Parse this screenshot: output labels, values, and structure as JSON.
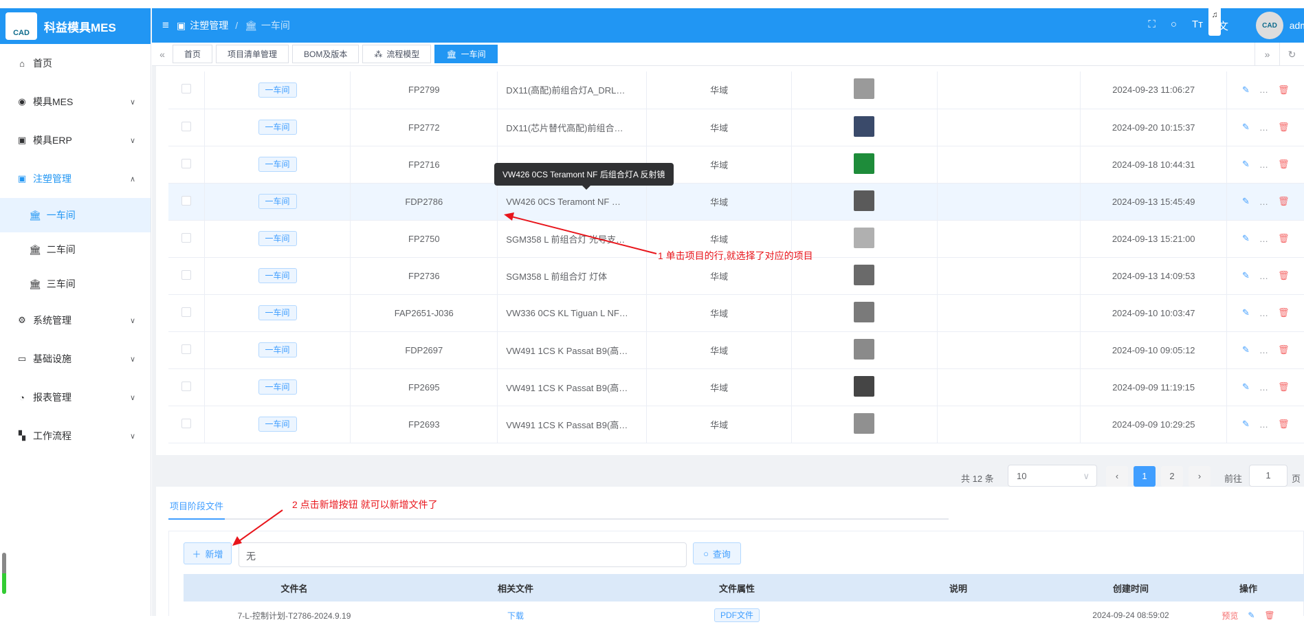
{
  "app": {
    "logo_text": "CAD",
    "title": "科益模具MES"
  },
  "sidebar": {
    "items": [
      {
        "label": "首页",
        "icon": "home-icon"
      },
      {
        "label": "模具MES",
        "icon": "camera-icon"
      },
      {
        "label": "模具ERP",
        "icon": "box-icon"
      },
      {
        "label": "注塑管理",
        "icon": "box-icon"
      },
      {
        "label": "系统管理",
        "icon": "gear-icon"
      },
      {
        "label": "基础设施",
        "icon": "monitor-icon"
      },
      {
        "label": "报表管理",
        "icon": "pie-icon"
      },
      {
        "label": "工作流程",
        "icon": "workflow-icon"
      }
    ],
    "sub_items": [
      {
        "label": "一车间"
      },
      {
        "label": "二车间"
      },
      {
        "label": "三车间"
      }
    ]
  },
  "header": {
    "breadcrumb_parent": "注塑管理",
    "breadcrumb_current": "一车间",
    "user": "adm"
  },
  "tags": [
    {
      "label": "首页"
    },
    {
      "label": "项目清单管理"
    },
    {
      "label": "BOM及版本"
    },
    {
      "label": "流程模型"
    },
    {
      "label": "一车间"
    }
  ],
  "table": {
    "rows": [
      {
        "workshop": "一车间",
        "code": "FP2799",
        "name": "DX11(高配)前组合灯A_DRL…",
        "customer": "华域",
        "thumb_color": "#9a9a9a",
        "created": "2024-09-23 11:06:27"
      },
      {
        "workshop": "一车间",
        "code": "FP2772",
        "name": "DX11(芯片替代高配)前组合…",
        "customer": "华域",
        "thumb_color": "#3a4a6a",
        "created": "2024-09-20 10:15:37"
      },
      {
        "workshop": "一车间",
        "code": "FP2716",
        "name": "",
        "customer": "华域",
        "thumb_color": "#1e8c3a",
        "created": "2024-09-18 10:44:31"
      },
      {
        "workshop": "一车间",
        "code": "FDP2786",
        "name": "VW426 0CS Teramont NF …",
        "customer": "华域",
        "thumb_color": "#5a5a5a",
        "created": "2024-09-13 15:45:49"
      },
      {
        "workshop": "一车间",
        "code": "FP2750",
        "name": "SGM358 L 前组合灯 光导支…",
        "customer": "华域",
        "thumb_color": "#b0b0b0",
        "created": "2024-09-13 15:21:00"
      },
      {
        "workshop": "一车间",
        "code": "FP2736",
        "name": "SGM358 L 前组合灯 灯体",
        "customer": "华域",
        "thumb_color": "#6a6a6a",
        "created": "2024-09-13 14:09:53"
      },
      {
        "workshop": "一车间",
        "code": "FAP2651-J036",
        "name": "VW336 0CS KL Tiguan L NF…",
        "customer": "华域",
        "thumb_color": "#7a7a7a",
        "created": "2024-09-10 10:03:47"
      },
      {
        "workshop": "一车间",
        "code": "FDP2697",
        "name": "VW491 1CS K Passat B9(高…",
        "customer": "华域",
        "thumb_color": "#8a8a8a",
        "created": "2024-09-10 09:05:12"
      },
      {
        "workshop": "一车间",
        "code": "FP2695",
        "name": "VW491 1CS K Passat B9(高…",
        "customer": "华域",
        "thumb_color": "#454545",
        "created": "2024-09-09 11:19:15"
      },
      {
        "workshop": "一车间",
        "code": "FP2693",
        "name": "VW491 1CS K Passat B9(高…",
        "customer": "华域",
        "thumb_color": "#909090",
        "created": "2024-09-09 10:29:25"
      }
    ],
    "tooltip": "VW426 0CS Teramont NF 后组合灯A 反射镜"
  },
  "pager": {
    "total": "共 12 条",
    "page_size": "10",
    "pages": [
      "1",
      "2"
    ],
    "goto_label": "前往",
    "goto_value": "1",
    "page_unit": "页"
  },
  "files": {
    "tab": "项目阶段文件",
    "add_label": "新增",
    "search_value": "无",
    "query_label": "查询",
    "columns": [
      "文件名",
      "相关文件",
      "文件属性",
      "说明",
      "创建时间",
      "操作"
    ],
    "row": {
      "name": "7-L-控制计划-T2786-2024.9.19",
      "download": "下载",
      "type": "PDF文件",
      "desc": "",
      "created": "2024-09-24 08:59:02",
      "preview": "预览"
    }
  },
  "annotations": {
    "note1": "1 单击项目的行,就选择了对应的项目",
    "note2": "2 点击新增按钮 就可以新增文件了"
  }
}
